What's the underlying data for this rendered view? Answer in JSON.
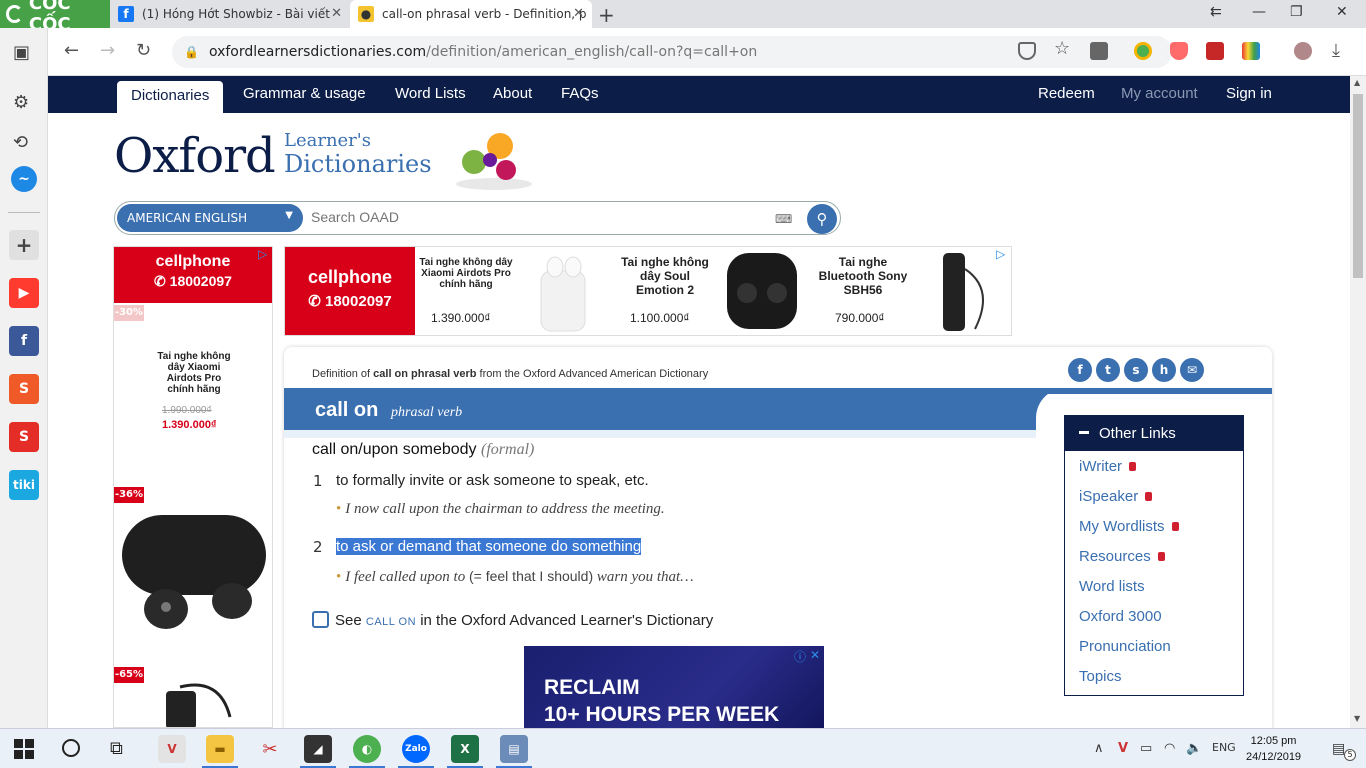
{
  "browser": {
    "brand": "CỐC CỐC",
    "tabs": [
      {
        "title": "(1) Hóng Hớt Showbiz - Bài viết",
        "active": false
      },
      {
        "title": "call-on phrasal verb - Definition, p",
        "active": true
      }
    ],
    "url_host": "oxfordlearnersdictionaries.com",
    "url_path": "/definition/american_english/call-on?q=call+on"
  },
  "site_nav": {
    "left": [
      "Dictionaries",
      "Grammar & usage",
      "Word Lists",
      "About",
      "FAQs"
    ],
    "right": [
      "Redeem",
      "My account",
      "Sign in"
    ]
  },
  "logo": {
    "oxford": "Oxford",
    "learners": "Learner's",
    "dictionaries": "Dictionaries"
  },
  "search": {
    "dropdown": "AMERICAN ENGLISH",
    "placeholder": "Search OAAD"
  },
  "ad_top": {
    "brand": "cellphone",
    "phone": "18002097",
    "products": [
      {
        "name": "Tai nghe không dây Xiaomi Airdots Pro chính hãng",
        "price": "1.390.000₫"
      },
      {
        "name": "Tai nghe không dây Soul Emotion 2",
        "price": "1.100.000₫"
      },
      {
        "name": "Tai nghe Bluetooth Sony SBH56",
        "price": "790.000₫"
      }
    ]
  },
  "ad_left": {
    "brand": "cellphone",
    "phone": "18002097",
    "product_name": "Tai nghe không dây Xiaomi Airdots Pro chính hãng",
    "old_price": "1.990.000₫",
    "new_price": "1.390.000₫",
    "discounts": [
      "-30%",
      "-36%",
      "-65%"
    ]
  },
  "entry": {
    "def_of_prefix": "Definition of",
    "def_of_term": "call on phrasal verb",
    "def_of_suffix": "from the Oxford Advanced American Dictionary",
    "headword": "call on",
    "pos": "phrasal verb",
    "idiom": "call on/upon somebody",
    "idiom_label": "formal",
    "senses": [
      {
        "num": "1",
        "definition": "to formally invite or ask someone to speak, etc.",
        "example": "I now call upon the chairman to address the meeting."
      },
      {
        "num": "2",
        "definition": "to ask or demand that someone do something",
        "example_a": "I feel called upon to",
        "example_b": "(= feel that I should)",
        "example_c": "warn you that…"
      }
    ],
    "see_prefix": "See",
    "see_term": "CALL ON",
    "see_suffix": "in the Oxford Advanced Learner's Dictionary"
  },
  "other_links": {
    "title": "Other Links",
    "items": [
      {
        "label": "iWriter",
        "locked": true
      },
      {
        "label": "iSpeaker",
        "locked": true
      },
      {
        "label": "My Wordlists",
        "locked": true
      },
      {
        "label": "Resources",
        "locked": true
      },
      {
        "label": "Word lists",
        "locked": false
      },
      {
        "label": "Oxford 3000",
        "locked": false
      },
      {
        "label": "Pronunciation",
        "locked": false
      },
      {
        "label": "Topics",
        "locked": false
      }
    ]
  },
  "ad_bottom": {
    "line1": "RECLAIM",
    "line2": "10+ HOURS PER WEEK"
  },
  "taskbar": {
    "lang": "ENG",
    "time": "12:05 pm",
    "date": "24/12/2019",
    "notif_count": "5"
  },
  "colors": {
    "oxford_navy": "#0c1e48",
    "oxford_blue": "#3a6fb0",
    "cellphones_red": "#d70018",
    "selection": "#3a78d4"
  }
}
